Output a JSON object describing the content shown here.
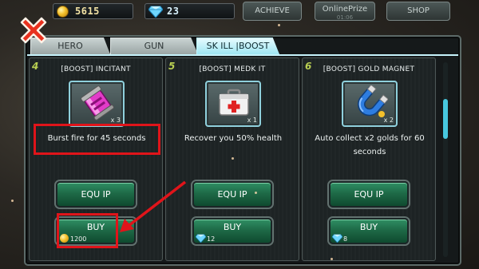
{
  "resources": {
    "gold": "5615",
    "gems": "23"
  },
  "top_buttons": {
    "achieve": "ACHIEVE",
    "online_prize": "OnlinePrize",
    "online_prize_sub": "01:06",
    "shop": "SHOP"
  },
  "tabs": [
    {
      "label": "HERO",
      "active": false
    },
    {
      "label": "GUN",
      "active": false
    },
    {
      "label": "SK ILL |BOOST",
      "active": true
    }
  ],
  "cards": [
    {
      "number": "4",
      "title": "[BOOST] INCITANT",
      "icon": "pink-canister-icon",
      "quantity": "x 3",
      "description": "Burst fire for 45 seconds",
      "equip_label": "EQU IP",
      "buy_label": "BUY",
      "price": "1200",
      "currency": "gold"
    },
    {
      "number": "5",
      "title": "[BOOST] MEDK IT",
      "icon": "medkit-icon",
      "quantity": "x 1",
      "description": "Recover you 50% health",
      "equip_label": "EQU IP",
      "buy_label": "BUY",
      "price": "12",
      "currency": "gem"
    },
    {
      "number": "6",
      "title": "[BOOST] GOLD MAGNET",
      "icon": "magnet-icon",
      "quantity": "x 2",
      "description": "Auto collect x2 golds for 60 seconds",
      "equip_label": "EQU IP",
      "buy_label": "BUY",
      "price": "8",
      "currency": "gem"
    }
  ],
  "colors": {
    "highlight": "#e0141a",
    "button_green": "#1e6a47",
    "tab_active": "#9ee6f2",
    "card_number": "#b9cf52"
  }
}
